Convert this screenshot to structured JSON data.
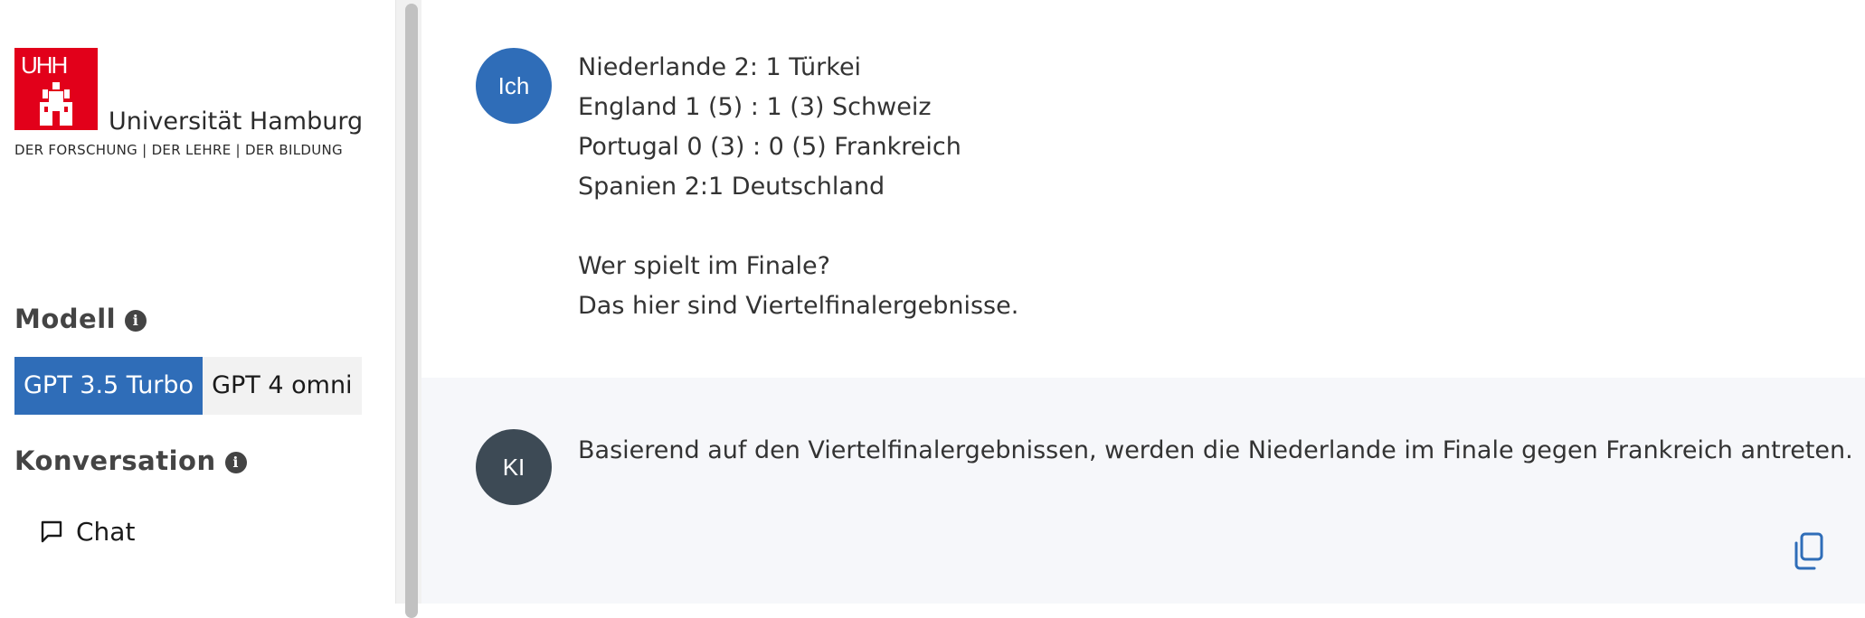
{
  "sidebar": {
    "logo": {
      "mark_text": "UHH",
      "name": "Universität Hamburg",
      "tagline": "DER FORSCHUNG | DER LEHRE | DER BILDUNG",
      "brand_color": "#e2001a"
    },
    "model_section": {
      "title": "Modell",
      "info_icon": "info-icon",
      "options": [
        "GPT 3.5 Turbo",
        "GPT 4 omni"
      ],
      "selected": "GPT 3.5 Turbo"
    },
    "conversation_section": {
      "title": "Konversation",
      "info_icon": "info-icon",
      "items": [
        {
          "label": "Chat",
          "icon": "chat-bubble-icon"
        }
      ]
    }
  },
  "conversation": {
    "messages": [
      {
        "role": "user",
        "avatar_label": "Ich",
        "avatar_color": "#2f6db8",
        "text": "Niederlande 2: 1 Türkei\nEngland 1 (5) : 1 (3) Schweiz\nPortugal 0 (3) : 0 (5) Frankreich\nSpanien 2:1 Deutschland\n\nWer spielt im Finale?\nDas hier sind Viertelfinalergebnisse."
      },
      {
        "role": "assistant",
        "avatar_label": "KI",
        "avatar_color": "#3d4a55",
        "text": "Basierend auf den Viertelfinalergebnissen, werden die Niederlande im Finale gegen Frankreich antreten.",
        "action_icon": "copy-icon"
      }
    ]
  },
  "colors": {
    "accent": "#2f6db8",
    "ai_background": "#f6f7fa"
  }
}
